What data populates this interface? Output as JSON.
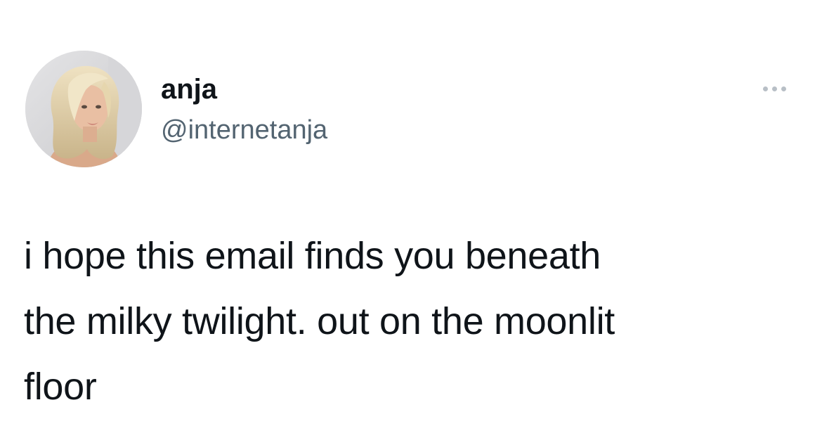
{
  "tweet": {
    "author": {
      "display_name": "anja",
      "handle": "@internetanja",
      "avatar_icon": "profile-photo-avatar"
    },
    "more_icon": "more-options-icon",
    "text": "i hope this email finds you beneath\nthe milky twilight. out on the moonlit\nfloor"
  },
  "colors": {
    "text_primary": "#0f1419",
    "text_secondary": "#536471",
    "background": "#ffffff",
    "icon_muted": "#b8bfc6"
  }
}
